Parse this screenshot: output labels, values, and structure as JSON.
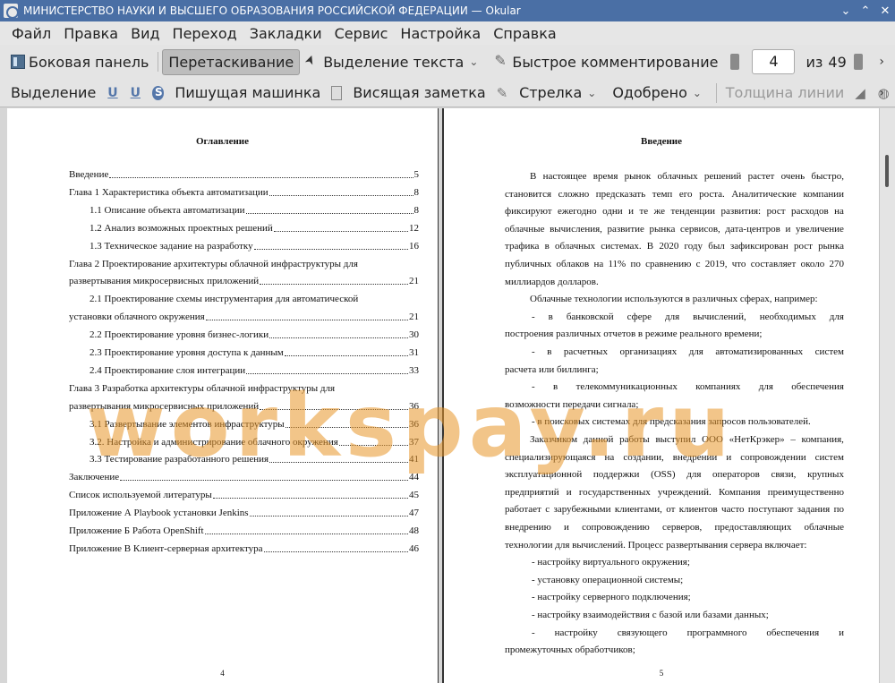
{
  "window": {
    "title": "МИНИСТЕРСТВО НАУКИ И ВЫСШЕГО ОБРАЗОВАНИЯ РОССИЙСКОЙ ФЕДЕРАЦИИ  — Okular",
    "controls": [
      "⌄",
      "⌃",
      "✕"
    ]
  },
  "menu": [
    "Файл",
    "Правка",
    "Вид",
    "Переход",
    "Закладки",
    "Сервис",
    "Настройка",
    "Справка"
  ],
  "toolbar": {
    "sidebar": "Боковая панель",
    "drag": "Перетаскивание",
    "text_select": "Выделение текста",
    "quick_comment": "Быстрое комментирование",
    "page_current": "4",
    "page_of": "из",
    "page_total": "49",
    "more": "›"
  },
  "annot_toolbar": {
    "highlight": "Выделение",
    "typewriter": "Пишущая машинка",
    "sticky": "Висящая заметка",
    "arrow": "Стрелка",
    "stamp": "Одобрено",
    "line_width": "Толщина линии",
    "more": "›"
  },
  "left_page": {
    "heading": "Оглавление",
    "number": "4",
    "toc": [
      {
        "text": "Введение",
        "page": "5"
      },
      {
        "text": "Глава 1 Характеристика объекта автоматизации",
        "page": "8"
      },
      {
        "text": "1.1 Описание объекта автоматизации",
        "page": "8"
      },
      {
        "text": "1.2 Анализ возможных проектных решений",
        "page": "12"
      },
      {
        "text": "1.3 Техническое задание на разработку",
        "page": "16"
      },
      {
        "text": "Глава 2 Проектирование архитектуры облачной инфраструктуры для",
        "cont": "развертывания микросервисных приложений",
        "page": "21"
      },
      {
        "text": "2.1 Проектирование схемы инструментария для автоматической",
        "cont": "установки облачного окружения",
        "page": "21"
      },
      {
        "text": "2.2 Проектирование уровня бизнес-логики",
        "page": "30"
      },
      {
        "text": "2.3 Проектирование уровня доступа к данным",
        "page": "31"
      },
      {
        "text": "2.4 Проектирование слоя интеграции",
        "page": "33"
      },
      {
        "text": "Глава 3 Разработка архитектуры облачной инфраструктуры для",
        "cont": "развертывания микросервисных приложений",
        "page": "36"
      },
      {
        "text": "3.1 Развертывание элементов инфраструктуры",
        "page": "36"
      },
      {
        "text": "3.2. Настройка и администрирование облачного окружения",
        "page": "37"
      },
      {
        "text": "3.3 Тестирование разработанного решения",
        "page": "41"
      },
      {
        "text": "Заключение",
        "page": "44"
      },
      {
        "text": "Список используемой литературы",
        "page": "45"
      },
      {
        "text": "Приложение А Playbook установки Jenkins",
        "page": "47"
      },
      {
        "text": "Приложение Б Работа OpenShift",
        "page": "48"
      },
      {
        "text": "Приложение В Клиент-серверная архитектура",
        "page": "46"
      }
    ]
  },
  "right_page": {
    "heading": "Введение",
    "number": "5",
    "lines": [
      "В настоящее время рынок облачных решений растет очень быстро,",
      "становится сложно предсказать темп его роста. Аналитические компании",
      "фиксируют ежегодно одни и те же тенденции развития: рост расходов на",
      "облачные вычисления, развитие рынка сервисов, дата-центров и увеличение",
      "трафика в облачных системах. В 2020 году был зафиксирован рост рынка",
      "публичных облаков на 11% по сравнению с 2019, что составляет около 270",
      "миллиардов долларов.",
      "Облачные технологии используются в различных сферах, например:",
      "-  в банковской сфере для вычислений, необходимых для",
      "построения различных отчетов в режиме реального времени;",
      "-  в расчетных организациях для автоматизированных систем",
      "расчета или биллинга;",
      "-  в телекоммуникационных компаниях для обеспечения",
      "возможности передачи сигнала;",
      "-  в поисковых системах для предсказания запросов пользователей.",
      "Заказчиком данной работы выступил ООО «НетКрэкер» – компания,",
      "специализирующаяся на создании, внедрении и сопровождении систем",
      "эксплуатационной поддержки (OSS) для операторов связи, крупных",
      "предприятий и государственных учреждений. Компания преимущественно",
      "работает с зарубежными клиентами, от клиентов часто поступают задания по",
      "внедрению и сопровождению серверов, предоставляющих облачные",
      "технологии для вычислений. Процесс развертывания сервера включает:",
      "-  настройку виртуального окружения;",
      "-  установку операционной системы;",
      "-  настройку серверного подключения;",
      "-  настройку взаимодействия с базой или базами данных;",
      "-  настройку связующего программного обеспечения и",
      "промежуточных обработчиков;"
    ]
  },
  "watermark": "workspay.ru"
}
